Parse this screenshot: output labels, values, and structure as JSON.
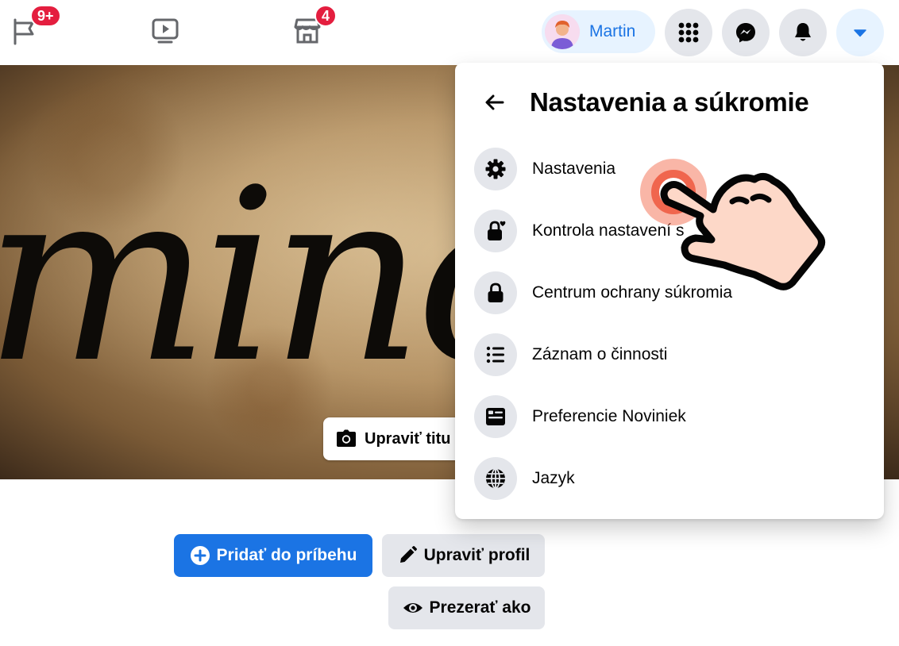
{
  "topbar": {
    "pages_badge": "9+",
    "marketplace_badge": "4",
    "profile_name": "Martin",
    "icons": [
      "flag-icon",
      "watch-icon",
      "marketplace-icon",
      "menu-grid-icon",
      "messenger-icon",
      "notifications-icon",
      "account-caret-icon"
    ]
  },
  "cover": {
    "script_text": "mino",
    "edit_cover_label": "Upraviť titu"
  },
  "profile_actions": {
    "add_story": "Pridať do príbehu",
    "edit_profile": "Upraviť profil",
    "view_as": "Prezerať ako"
  },
  "menu": {
    "title": "Nastavenia a súkromie",
    "items": [
      {
        "label": "Nastavenia",
        "icon": "gear-icon"
      },
      {
        "label": "Kontrola nastavení s",
        "icon": "lock-heart-icon"
      },
      {
        "label": "Centrum ochrany súkromia",
        "icon": "lock-icon"
      },
      {
        "label": "Záznam o činnosti",
        "icon": "list-icon"
      },
      {
        "label": "Preferencie Noviniek",
        "icon": "news-feed-icon"
      },
      {
        "label": "Jazyk",
        "icon": "globe-icon"
      }
    ]
  },
  "colors": {
    "accent": "#1b74e4",
    "badge": "#e41e3f",
    "chip_bg": "#e7f3ff",
    "button_grey": "#e4e6eb",
    "tap_ring": "#f0664e",
    "hand_fill": "#fdd8c8"
  }
}
